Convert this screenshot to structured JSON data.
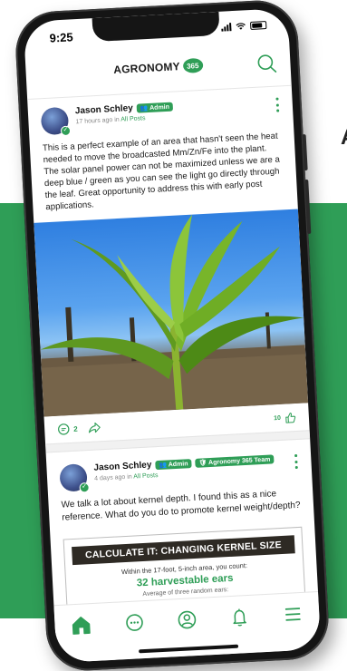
{
  "colors": {
    "brand_green": "#2f9e57",
    "background_band": "#2f9e57",
    "phone_frame": "#151515"
  },
  "side_text": "A",
  "status_bar": {
    "time": "9:25"
  },
  "header": {
    "logo_text": "AGRONOMY",
    "logo_badge": "365",
    "search_icon": "search-icon"
  },
  "posts": [
    {
      "author": "Jason Schley",
      "badges": [
        "Admin"
      ],
      "time_ago": "17 hours ago in",
      "group": "All Posts",
      "body": "This is a perfect example of an area that hasn't seen the heat needed to move the broadcasted Mm/Zn/Fe into the plant. The solar panel power can not be maximized unless we are a deep blue / green as you can see the light go directly through the leaf. Great opportunity to address this with early post applications.",
      "image_icon": "corn-plant-photo",
      "comments": "2",
      "likes": "10"
    },
    {
      "author": "Jason Schley",
      "badges": [
        "Admin",
        "Agronomy 365 Team"
      ],
      "time_ago": "4 days ago in",
      "group": "All Posts",
      "body": "We talk a lot about kernel depth. I found this as a nice reference. What do you do to promote kernel weight/depth?",
      "card": {
        "title": "CALCULATE IT: CHANGING KERNEL SIZE",
        "subtitle": "Within the 17-foot, 5-inch area, you count:",
        "highlight": "32 harvestable ears",
        "cut_line": "Average of three random ears:"
      }
    }
  ],
  "bottom_nav": [
    {
      "icon": "home-icon",
      "active": true
    },
    {
      "icon": "chat-icon",
      "active": false
    },
    {
      "icon": "profile-icon",
      "active": false
    },
    {
      "icon": "bell-icon",
      "active": false
    },
    {
      "icon": "menu-icon",
      "active": false
    }
  ]
}
